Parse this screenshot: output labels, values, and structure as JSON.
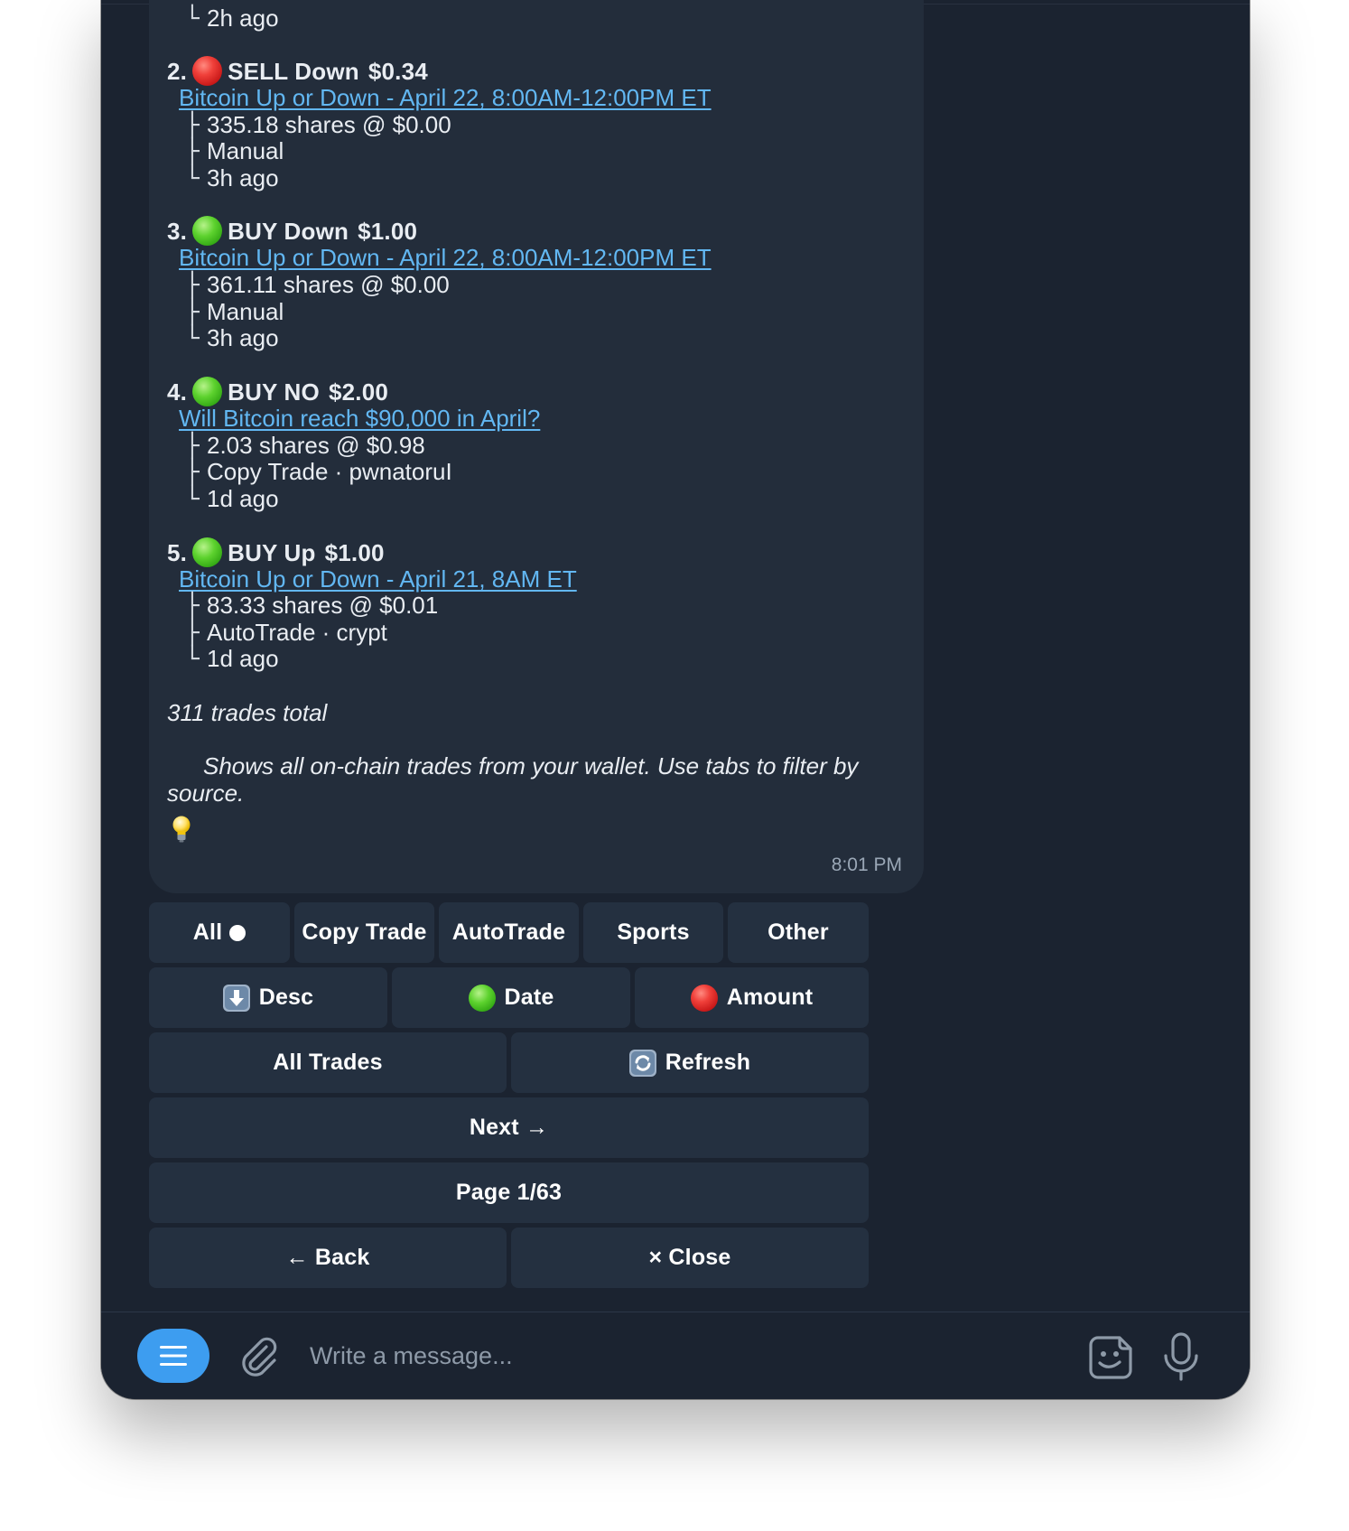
{
  "trades": [
    {
      "tail": "2h ago"
    },
    {
      "number": "2.",
      "dot_color": "red",
      "side": "SELL Down",
      "amount": "$0.34",
      "market": "Bitcoin Up or Down - April 22, 8:00AM-12:00PM ET",
      "shares": "335.18 shares @ $0.00",
      "source": "Manual",
      "age": "3h ago"
    },
    {
      "number": "3.",
      "dot_color": "green",
      "side": "BUY Down",
      "amount": "$1.00",
      "market": "Bitcoin Up or Down - April 22, 8:00AM-12:00PM ET",
      "shares": "361.11 shares @ $0.00",
      "source": "Manual",
      "age": "3h ago"
    },
    {
      "number": "4.",
      "dot_color": "green",
      "side": "BUY NO",
      "amount": "$2.00",
      "market": "Will Bitcoin reach $90,000 in April?",
      "shares": "2.03 shares @ $0.98",
      "source": "Copy Trade · pwnatoruI",
      "age": "1d ago"
    },
    {
      "number": "5.",
      "dot_color": "green",
      "side": "BUY Up",
      "amount": "$1.00",
      "market": "Bitcoin Up or Down - April 21, 8AM ET",
      "shares": "83.33 shares @ $0.01",
      "source": "AutoTrade · crypt",
      "age": "1d ago"
    }
  ],
  "tree_glyphs": {
    "branch": "├",
    "last": "└"
  },
  "summary": "311 trades total",
  "tip": "Shows all on-chain trades from your wallet. Use tabs to filter by",
  "tip_cont": "source.",
  "time": "8:01 PM",
  "keyboard": {
    "tabs": [
      "All",
      "Copy Trade",
      "AutoTrade",
      "Sports",
      "Other"
    ],
    "sort_desc": "Desc",
    "sort_date": "Date",
    "sort_amount": "Amount",
    "all_trades": "All Trades",
    "refresh": "Refresh",
    "next": "Next →",
    "page": "Page 1/63",
    "back": "← Back",
    "close": "× Close"
  },
  "composer": {
    "placeholder": "Write a message..."
  },
  "colors": {
    "window_bg": "#1b2330",
    "bubble_bg": "#232d3b",
    "button_bg": "#243040",
    "link": "#62b7f2",
    "accent": "#3d9df0",
    "red_dot": "#e53935",
    "green_dot": "#43c51c"
  }
}
